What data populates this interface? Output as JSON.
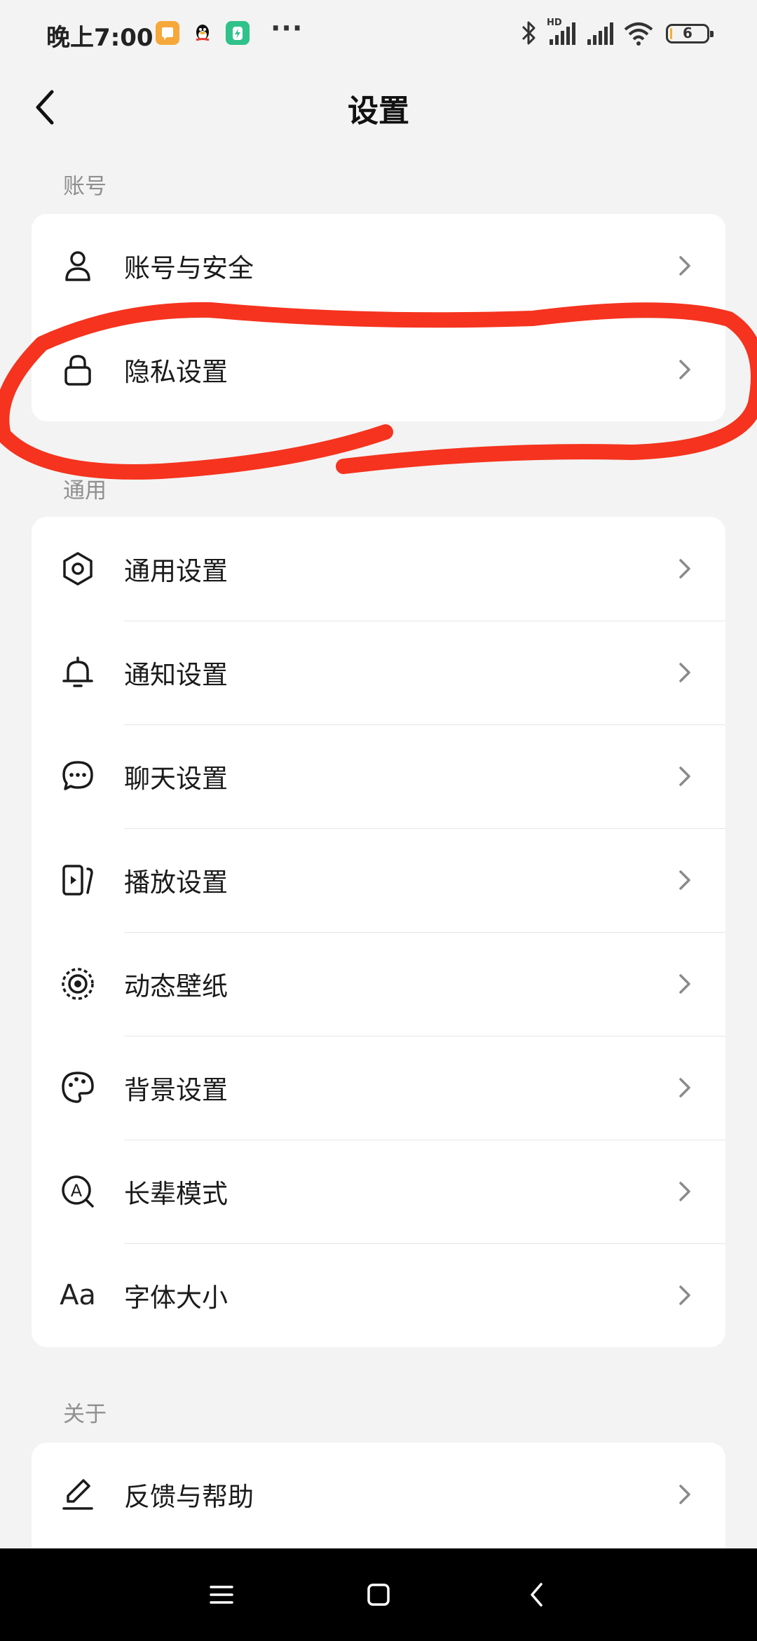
{
  "status_bar": {
    "time": "晚上7:00",
    "battery": "6",
    "battery_percent": 6,
    "icons": [
      "notes-app-icon",
      "qq-icon",
      "charging-app-icon",
      "more-dots-icon",
      "bluetooth-icon",
      "hd-signal-icon",
      "signal-icon",
      "wifi-icon",
      "battery-icon"
    ]
  },
  "header": {
    "title": "设置",
    "back_icon": "chevron-left-icon"
  },
  "sections": {
    "account": {
      "label": "账号",
      "items": [
        {
          "label": "账号与安全",
          "icon": "user-icon"
        },
        {
          "label": "隐私设置",
          "icon": "lock-icon"
        }
      ]
    },
    "general": {
      "label": "通用",
      "items": [
        {
          "label": "通用设置",
          "icon": "gear-icon"
        },
        {
          "label": "通知设置",
          "icon": "bell-icon"
        },
        {
          "label": "聊天设置",
          "icon": "chat-bubble-icon"
        },
        {
          "label": "播放设置",
          "icon": "play-screen-icon"
        },
        {
          "label": "动态壁纸",
          "icon": "live-wallpaper-icon"
        },
        {
          "label": "背景设置",
          "icon": "palette-icon"
        },
        {
          "label": "长辈模式",
          "icon": "elder-mode-icon"
        },
        {
          "label": "字体大小",
          "icon": "font-size-icon",
          "icon_text": "Aa"
        }
      ]
    },
    "about": {
      "label": "关于",
      "items": [
        {
          "label": "反馈与帮助",
          "icon": "pen-icon"
        }
      ]
    }
  },
  "annotation": {
    "type": "hand-drawn red circle around 隐私设置",
    "color": "#f5331e"
  },
  "nav_bar": {
    "buttons": [
      "menu-icon",
      "home-icon",
      "back-icon"
    ]
  }
}
